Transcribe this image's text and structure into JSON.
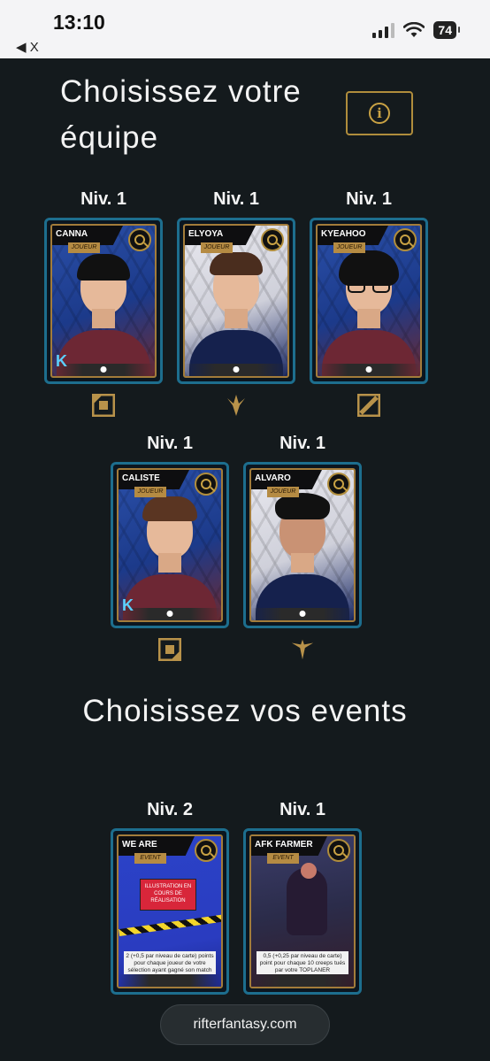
{
  "status_bar": {
    "time": "13:10",
    "back_label": "◀ X",
    "battery": "74"
  },
  "team_section": {
    "title": "Choisissez votre équipe",
    "info_icon": "info-icon",
    "players": [
      {
        "level": "Niv. 1",
        "name": "CANNA",
        "role_tag": "JOUEUR",
        "role": "top-lane-icon",
        "theme": "blue"
      },
      {
        "level": "Niv. 1",
        "name": "ELYOYA",
        "role_tag": "JOUEUR",
        "role": "jungle-icon",
        "theme": "white"
      },
      {
        "level": "Niv. 1",
        "name": "KYEAHOO",
        "role_tag": "JOUEUR",
        "role": "mid-lane-icon",
        "theme": "blue"
      },
      {
        "level": "Niv. 1",
        "name": "CALISTE",
        "role_tag": "JOUEUR",
        "role": "bot-lane-icon",
        "theme": "blue"
      },
      {
        "level": "Niv. 1",
        "name": "ALVARO",
        "role_tag": "JOUEUR",
        "role": "support-icon",
        "theme": "white"
      }
    ]
  },
  "events_section": {
    "title": "Choisissez vos events",
    "events": [
      {
        "level": "Niv. 2",
        "name": "WE ARE WINNERS",
        "tag": "EVENT",
        "sign_text": "ILLUSTRATION EN COURS DE RÉALISATION",
        "description": "2 (+0,5 par niveau de carte) points pour chaque joueur de votre sélection ayant gagné son match"
      },
      {
        "level": "Niv. 1",
        "name": "AFK FARMER TOP",
        "tag": "EVENT",
        "description": "0,5 (+0,25 par niveau de carte) point pour chaque 10 creeps tués par votre TOPLANER"
      }
    ]
  },
  "footer": {
    "url": "rifterfantasy.com"
  },
  "colors": {
    "background": "#141a1d",
    "gold": "#c9a244",
    "card_border": "#1d6e8e"
  }
}
